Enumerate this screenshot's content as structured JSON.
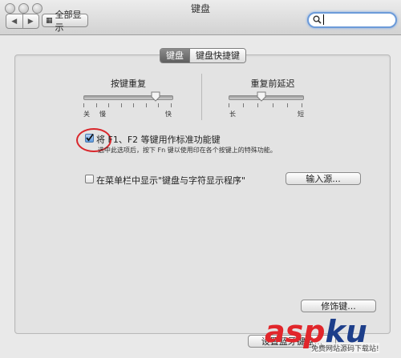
{
  "window": {
    "title": "键盘"
  },
  "toolbar": {
    "back_icon": "back-arrow-icon",
    "forward_icon": "forward-arrow-icon",
    "show_all_label": "全部显示",
    "search_value": ""
  },
  "tabs": [
    {
      "label": "键盘",
      "active": true
    },
    {
      "label": "键盘快捷键",
      "active": false
    }
  ],
  "key_repeat": {
    "title": "按键重复",
    "min_label": "关",
    "slow_label": "慢",
    "max_label": "快",
    "value": 0.82
  },
  "delay_until_repeat": {
    "title": "重复前延迟",
    "min_label": "长",
    "max_label": "短",
    "value": 0.45
  },
  "fn_keys": {
    "label": "将 F1、F2 等键用作标准功能键",
    "checked": true,
    "description": "选中此选项后，按下 Fn 键以使用印在各个按键上的特殊功能。"
  },
  "menu_bar": {
    "label": "在菜单栏中显示\"键盘与字符显示程序\"",
    "checked": false
  },
  "buttons": {
    "input_sources": "输入源...",
    "modifier_keys": "修饰键...",
    "setup_keyboard": "设置蓝牙键盘..."
  },
  "watermark": {
    "brand_a": "asp",
    "brand_b": "ku",
    "sub": "免费网站源码下载站!"
  },
  "colors": {
    "accent_ring": "#d9262b",
    "search_focus": "#6c9bd9",
    "active_tab": "#6f6f6f"
  }
}
